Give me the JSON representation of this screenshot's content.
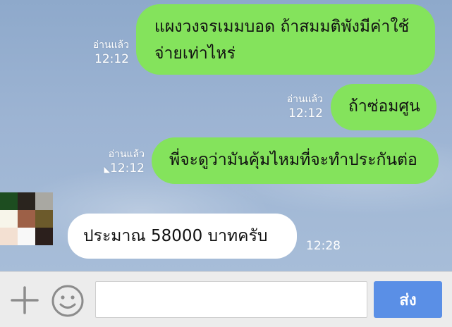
{
  "messages_out": [
    {
      "text_line1": "แผงวงจรเมมบอด ถ้าสมมติพังมีค่าใช้",
      "text_line2": "จ่ายเท่าไหร่",
      "read_label": "อ่านแล้ว",
      "time": "12:12"
    },
    {
      "text": "ถ้าซ่อมศูน",
      "read_label": "อ่านแล้ว",
      "time": "12:12"
    },
    {
      "text": "พี่จะดูว่ามันคุ้มไหมที่จะทำประกันต่อ",
      "read_label": "อ่านแล้ว",
      "time": "12:12"
    }
  ],
  "message_in": {
    "text": "ประมาณ 58000 บาทครับ",
    "time": "12:28"
  },
  "composer": {
    "input_value": "",
    "send_label": "ส่ง",
    "plus_icon": "plus-icon",
    "emoji_icon": "smiley-icon"
  },
  "colors": {
    "outgoing_bubble": "#84e35c",
    "send_button": "#5a8fe6",
    "incoming_bubble": "#ffffff"
  }
}
